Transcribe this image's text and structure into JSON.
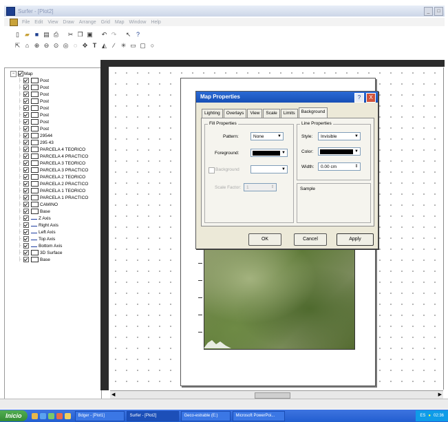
{
  "window": {
    "title": "Surfer - [Plot2]",
    "buttons": [
      "_",
      "□"
    ]
  },
  "menu": {
    "items": [
      "File",
      "Edit",
      "View",
      "Draw",
      "Arrange",
      "Grid",
      "Map",
      "Window",
      "Help"
    ]
  },
  "tree": {
    "nodes": [
      {
        "label": "Map",
        "indent": 0,
        "icon": "map"
      },
      {
        "label": "Post",
        "indent": 1,
        "icon": "post"
      },
      {
        "label": "Post",
        "indent": 1,
        "icon": "post"
      },
      {
        "label": "Post",
        "indent": 1,
        "icon": "post"
      },
      {
        "label": "Post",
        "indent": 1,
        "icon": "post"
      },
      {
        "label": "Post",
        "indent": 1,
        "icon": "post"
      },
      {
        "label": "Post",
        "indent": 1,
        "icon": "post"
      },
      {
        "label": "Post",
        "indent": 1,
        "icon": "post"
      },
      {
        "label": "Post",
        "indent": 1,
        "icon": "post"
      },
      {
        "label": "29544",
        "indent": 1,
        "icon": "post"
      },
      {
        "label": "295 43",
        "indent": 1,
        "icon": "post"
      },
      {
        "label": "PARCELA 4 TEORICO",
        "indent": 1,
        "icon": "post"
      },
      {
        "label": "PARCELA 4 PRACTICO",
        "indent": 1,
        "icon": "post"
      },
      {
        "label": "PARCELA 3 TEORICO",
        "indent": 1,
        "icon": "post"
      },
      {
        "label": "PARCELA 3 PRACTICO",
        "indent": 1,
        "icon": "post"
      },
      {
        "label": "PARCELA 2 TEORICO",
        "indent": 1,
        "icon": "post"
      },
      {
        "label": "PARCELA 2 PRACTICO",
        "indent": 1,
        "icon": "post"
      },
      {
        "label": "PARCELA 1 TEORICO",
        "indent": 1,
        "icon": "post"
      },
      {
        "label": "PARCELA 1 PRACTICO",
        "indent": 1,
        "icon": "post"
      },
      {
        "label": "CAMINO",
        "indent": 1,
        "icon": "post"
      },
      {
        "label": "Base",
        "indent": 1,
        "icon": "post"
      },
      {
        "label": "Z Axis",
        "indent": 1,
        "icon": "axis"
      },
      {
        "label": "Right Axis",
        "indent": 1,
        "icon": "axis"
      },
      {
        "label": "Left Axis",
        "indent": 1,
        "icon": "axis"
      },
      {
        "label": "Top Axis",
        "indent": 1,
        "icon": "axis"
      },
      {
        "label": "Bottom Axis",
        "indent": 1,
        "icon": "axis"
      },
      {
        "label": "3D Surface",
        "indent": 1,
        "icon": "surface"
      },
      {
        "label": "Base",
        "indent": 1,
        "icon": "post"
      }
    ]
  },
  "dialog": {
    "title": "Map Properties",
    "help": "?",
    "close": "X",
    "tabs": [
      "Lighting",
      "Overlays",
      "View",
      "Scale",
      "Limits",
      "Background"
    ],
    "active_tab": "Background",
    "fill": {
      "group_label": "Fill Properties",
      "pattern_label": "Pattern:",
      "pattern_value": "None",
      "foreground_label": "Foreground:",
      "background_label": "Background",
      "scale_label": "Scale Factor:",
      "scale_value": "1"
    },
    "line": {
      "group_label": "Line Properties",
      "style_label": "Style:",
      "style_value": "Invisible",
      "color_label": "Color:",
      "width_label": "Width:",
      "width_value": "0.00 cm"
    },
    "sample_label": "Sample",
    "ok": "OK",
    "cancel": "Cancel",
    "apply": "Apply"
  },
  "taskbar": {
    "start": "Inicio",
    "tasks": [
      "Bdger - [Plot1]",
      "Surfer - [Plot2]",
      "Geco-estrable (E:)",
      "Microsoft PowerPoi..."
    ],
    "tray_lang": "ES",
    "tray_time": "02:36"
  },
  "colors": {
    "title_active": "#174fb6",
    "taskbar": "#225ed0",
    "dialog_bg": "#ece9d8"
  }
}
